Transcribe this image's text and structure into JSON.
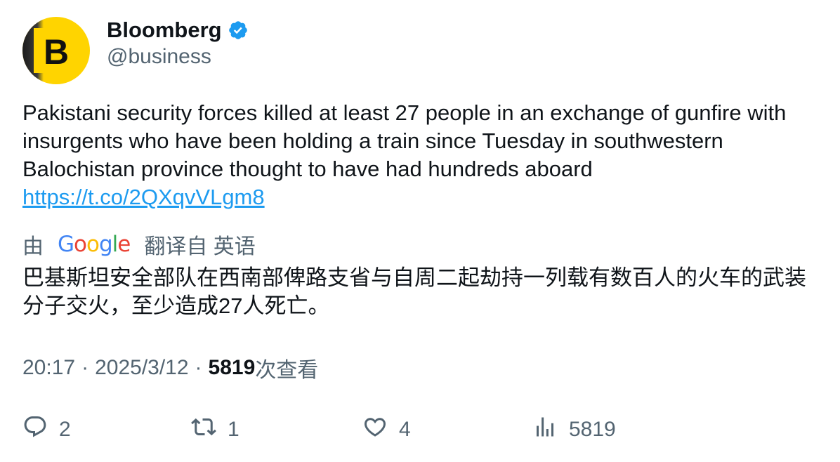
{
  "author": {
    "name": "Bloomberg",
    "handle": "@business",
    "avatar_letter": "B",
    "verified_icon": "verified-badge-icon",
    "verified_color": "#1d9bf0",
    "avatar_color": "#ffd400"
  },
  "tweet": {
    "text": "Pakistani security forces killed at least 27 people in an exchange of gunfire with insurgents who have been holding a train since Tuesday in southwestern Balochistan province thought to have had hundreds aboard",
    "link": "https://t.co/2QXqvVLgm8"
  },
  "translation": {
    "by_label": "由",
    "provider": "Google",
    "from_label": "翻译自 英语",
    "text": "巴基斯坦安全部队在西南部俾路支省与自周二起劫持一列载有数百人的火车的武装分子交火，至少造成27人死亡。"
  },
  "meta": {
    "time": "20:17",
    "date": "2025/3/12",
    "views_count": "5819",
    "views_label": "次查看"
  },
  "actions": {
    "reply_count": "2",
    "retweet_count": "1",
    "like_count": "4",
    "views_count": "5819"
  },
  "colors": {
    "text": "#0f1419",
    "secondary": "#536471",
    "link": "#1d9bf0"
  }
}
